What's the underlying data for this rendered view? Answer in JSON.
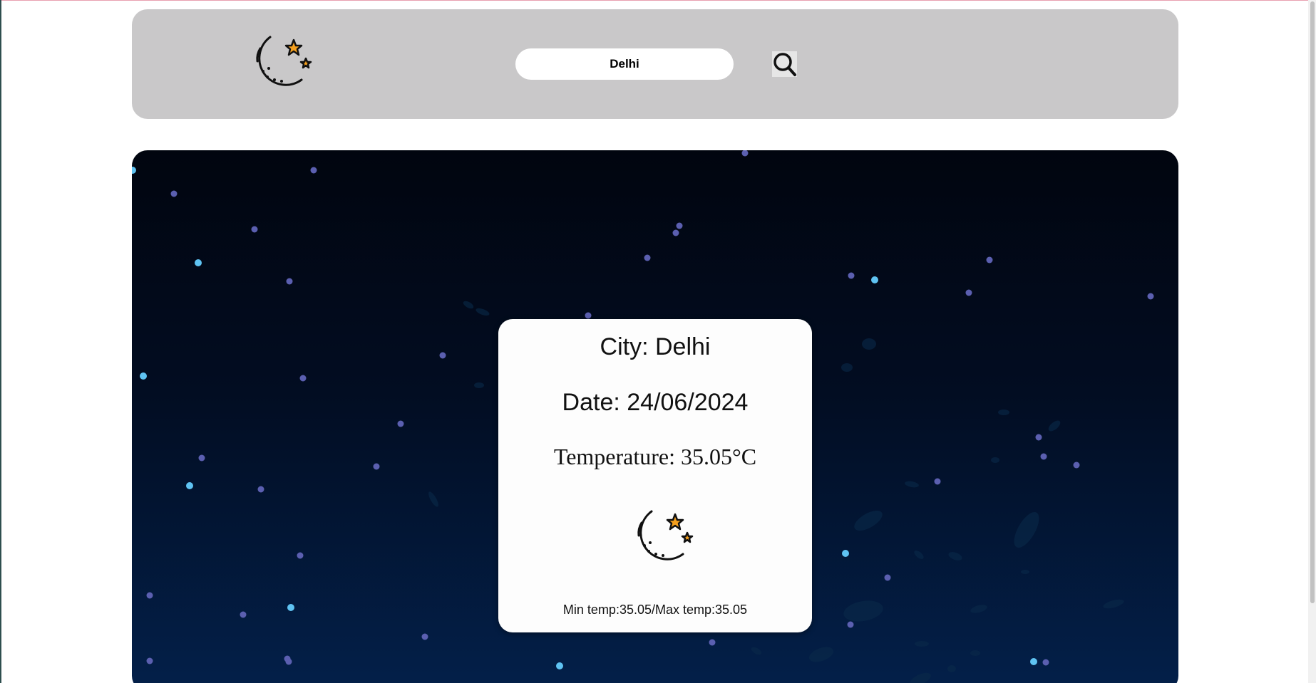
{
  "search": {
    "value": "Delhi"
  },
  "weather": {
    "city": "City: Delhi",
    "date": "Date: 24/06/2024",
    "temperature": "Temperature: 35.05°C",
    "minmax": "Min temp:35.05/Max temp:35.05",
    "icon": "moon-stars-icon"
  },
  "header": {
    "logo_icon": "moon-stars-icon",
    "search_icon": "search-icon"
  },
  "colors": {
    "header_bg": "#c9c8c9",
    "moon": "#f5a01e",
    "sky_top": "#01050f",
    "sky_bottom": "#03204a",
    "star_dim": "#5b5fb0",
    "star_bright": "#5fc3f2"
  }
}
